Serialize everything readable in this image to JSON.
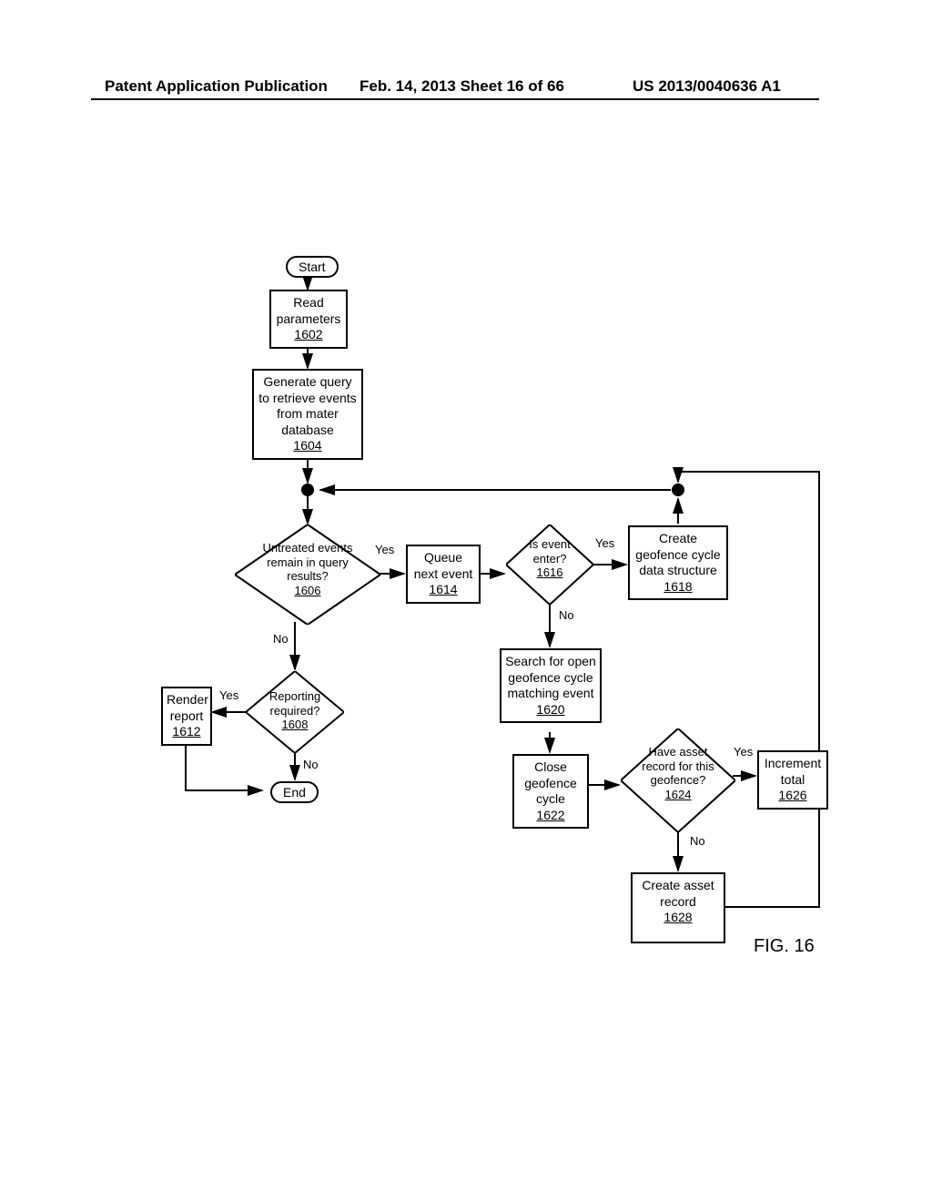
{
  "header": {
    "left": "Patent Application Publication",
    "center": "Feb. 14, 2013  Sheet 16 of 66",
    "right": "US 2013/0040636 A1"
  },
  "terminators": {
    "start": "Start",
    "end": "End"
  },
  "processes": {
    "p1602_text": "Read parameters",
    "p1602_ref": "1602",
    "p1604_text": "Generate query to retrieve events from mater database",
    "p1604_ref": "1604",
    "p1614_text": "Queue next event",
    "p1614_ref": "1614",
    "p1618_text": "Create geofence cycle data structure",
    "p1618_ref": "1618",
    "p1620_text": "Search for open geofence cycle matching event",
    "p1620_ref": "1620",
    "p1622_text": "Close geofence cycle",
    "p1622_ref": "1622",
    "p1626_text": "Increment total",
    "p1626_ref": "1626",
    "p1628_text": "Create asset record",
    "p1628_ref": "1628",
    "p1612_text": "Render report",
    "p1612_ref": "1612"
  },
  "decisions": {
    "d1606_text": "Untreated events remain in query results?",
    "d1606_ref": "1606",
    "d1616_text": "Is event enter?",
    "d1616_ref": "1616",
    "d1608_text": "Reporting required?",
    "d1608_ref": "1608",
    "d1624_text": "Have asset record for this geofence?",
    "d1624_ref": "1624"
  },
  "labels": {
    "yes": "Yes",
    "no": "No"
  },
  "figure": "FIG. 16"
}
